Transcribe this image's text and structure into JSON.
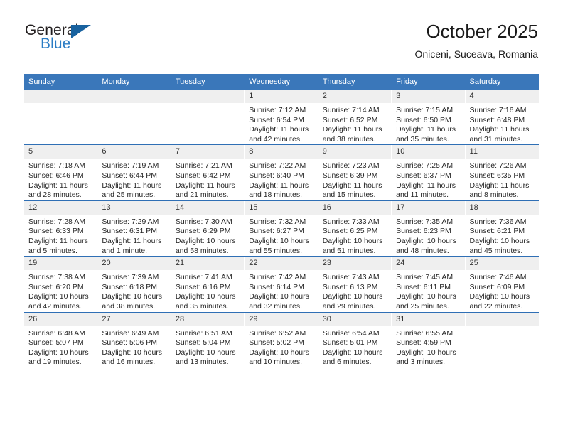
{
  "logo": {
    "word_top": "General",
    "word_bottom": "Blue",
    "accent_color": "#18629f",
    "blue_text_color": "#2b7cc4"
  },
  "header": {
    "title": "October 2025",
    "location": "Oniceni, Suceava, Romania"
  },
  "calendar": {
    "header_bg": "#3a77ba",
    "divider_color": "#2f6fb5",
    "daynum_bg": "#efefef",
    "weekdays": [
      "Sunday",
      "Monday",
      "Tuesday",
      "Wednesday",
      "Thursday",
      "Friday",
      "Saturday"
    ],
    "labels": {
      "sunrise": "Sunrise:",
      "sunset": "Sunset:",
      "daylight": "Daylight:"
    },
    "weeks": [
      [
        {
          "day": ""
        },
        {
          "day": ""
        },
        {
          "day": ""
        },
        {
          "day": "1",
          "sunrise": "Sunrise: 7:12 AM",
          "sunset": "Sunset: 6:54 PM",
          "daylight_1": "Daylight: 11 hours",
          "daylight_2": "and 42 minutes."
        },
        {
          "day": "2",
          "sunrise": "Sunrise: 7:14 AM",
          "sunset": "Sunset: 6:52 PM",
          "daylight_1": "Daylight: 11 hours",
          "daylight_2": "and 38 minutes."
        },
        {
          "day": "3",
          "sunrise": "Sunrise: 7:15 AM",
          "sunset": "Sunset: 6:50 PM",
          "daylight_1": "Daylight: 11 hours",
          "daylight_2": "and 35 minutes."
        },
        {
          "day": "4",
          "sunrise": "Sunrise: 7:16 AM",
          "sunset": "Sunset: 6:48 PM",
          "daylight_1": "Daylight: 11 hours",
          "daylight_2": "and 31 minutes."
        }
      ],
      [
        {
          "day": "5",
          "sunrise": "Sunrise: 7:18 AM",
          "sunset": "Sunset: 6:46 PM",
          "daylight_1": "Daylight: 11 hours",
          "daylight_2": "and 28 minutes."
        },
        {
          "day": "6",
          "sunrise": "Sunrise: 7:19 AM",
          "sunset": "Sunset: 6:44 PM",
          "daylight_1": "Daylight: 11 hours",
          "daylight_2": "and 25 minutes."
        },
        {
          "day": "7",
          "sunrise": "Sunrise: 7:21 AM",
          "sunset": "Sunset: 6:42 PM",
          "daylight_1": "Daylight: 11 hours",
          "daylight_2": "and 21 minutes."
        },
        {
          "day": "8",
          "sunrise": "Sunrise: 7:22 AM",
          "sunset": "Sunset: 6:40 PM",
          "daylight_1": "Daylight: 11 hours",
          "daylight_2": "and 18 minutes."
        },
        {
          "day": "9",
          "sunrise": "Sunrise: 7:23 AM",
          "sunset": "Sunset: 6:39 PM",
          "daylight_1": "Daylight: 11 hours",
          "daylight_2": "and 15 minutes."
        },
        {
          "day": "10",
          "sunrise": "Sunrise: 7:25 AM",
          "sunset": "Sunset: 6:37 PM",
          "daylight_1": "Daylight: 11 hours",
          "daylight_2": "and 11 minutes."
        },
        {
          "day": "11",
          "sunrise": "Sunrise: 7:26 AM",
          "sunset": "Sunset: 6:35 PM",
          "daylight_1": "Daylight: 11 hours",
          "daylight_2": "and 8 minutes."
        }
      ],
      [
        {
          "day": "12",
          "sunrise": "Sunrise: 7:28 AM",
          "sunset": "Sunset: 6:33 PM",
          "daylight_1": "Daylight: 11 hours",
          "daylight_2": "and 5 minutes."
        },
        {
          "day": "13",
          "sunrise": "Sunrise: 7:29 AM",
          "sunset": "Sunset: 6:31 PM",
          "daylight_1": "Daylight: 11 hours",
          "daylight_2": "and 1 minute."
        },
        {
          "day": "14",
          "sunrise": "Sunrise: 7:30 AM",
          "sunset": "Sunset: 6:29 PM",
          "daylight_1": "Daylight: 10 hours",
          "daylight_2": "and 58 minutes."
        },
        {
          "day": "15",
          "sunrise": "Sunrise: 7:32 AM",
          "sunset": "Sunset: 6:27 PM",
          "daylight_1": "Daylight: 10 hours",
          "daylight_2": "and 55 minutes."
        },
        {
          "day": "16",
          "sunrise": "Sunrise: 7:33 AM",
          "sunset": "Sunset: 6:25 PM",
          "daylight_1": "Daylight: 10 hours",
          "daylight_2": "and 51 minutes."
        },
        {
          "day": "17",
          "sunrise": "Sunrise: 7:35 AM",
          "sunset": "Sunset: 6:23 PM",
          "daylight_1": "Daylight: 10 hours",
          "daylight_2": "and 48 minutes."
        },
        {
          "day": "18",
          "sunrise": "Sunrise: 7:36 AM",
          "sunset": "Sunset: 6:21 PM",
          "daylight_1": "Daylight: 10 hours",
          "daylight_2": "and 45 minutes."
        }
      ],
      [
        {
          "day": "19",
          "sunrise": "Sunrise: 7:38 AM",
          "sunset": "Sunset: 6:20 PM",
          "daylight_1": "Daylight: 10 hours",
          "daylight_2": "and 42 minutes."
        },
        {
          "day": "20",
          "sunrise": "Sunrise: 7:39 AM",
          "sunset": "Sunset: 6:18 PM",
          "daylight_1": "Daylight: 10 hours",
          "daylight_2": "and 38 minutes."
        },
        {
          "day": "21",
          "sunrise": "Sunrise: 7:41 AM",
          "sunset": "Sunset: 6:16 PM",
          "daylight_1": "Daylight: 10 hours",
          "daylight_2": "and 35 minutes."
        },
        {
          "day": "22",
          "sunrise": "Sunrise: 7:42 AM",
          "sunset": "Sunset: 6:14 PM",
          "daylight_1": "Daylight: 10 hours",
          "daylight_2": "and 32 minutes."
        },
        {
          "day": "23",
          "sunrise": "Sunrise: 7:43 AM",
          "sunset": "Sunset: 6:13 PM",
          "daylight_1": "Daylight: 10 hours",
          "daylight_2": "and 29 minutes."
        },
        {
          "day": "24",
          "sunrise": "Sunrise: 7:45 AM",
          "sunset": "Sunset: 6:11 PM",
          "daylight_1": "Daylight: 10 hours",
          "daylight_2": "and 25 minutes."
        },
        {
          "day": "25",
          "sunrise": "Sunrise: 7:46 AM",
          "sunset": "Sunset: 6:09 PM",
          "daylight_1": "Daylight: 10 hours",
          "daylight_2": "and 22 minutes."
        }
      ],
      [
        {
          "day": "26",
          "sunrise": "Sunrise: 6:48 AM",
          "sunset": "Sunset: 5:07 PM",
          "daylight_1": "Daylight: 10 hours",
          "daylight_2": "and 19 minutes."
        },
        {
          "day": "27",
          "sunrise": "Sunrise: 6:49 AM",
          "sunset": "Sunset: 5:06 PM",
          "daylight_1": "Daylight: 10 hours",
          "daylight_2": "and 16 minutes."
        },
        {
          "day": "28",
          "sunrise": "Sunrise: 6:51 AM",
          "sunset": "Sunset: 5:04 PM",
          "daylight_1": "Daylight: 10 hours",
          "daylight_2": "and 13 minutes."
        },
        {
          "day": "29",
          "sunrise": "Sunrise: 6:52 AM",
          "sunset": "Sunset: 5:02 PM",
          "daylight_1": "Daylight: 10 hours",
          "daylight_2": "and 10 minutes."
        },
        {
          "day": "30",
          "sunrise": "Sunrise: 6:54 AM",
          "sunset": "Sunset: 5:01 PM",
          "daylight_1": "Daylight: 10 hours",
          "daylight_2": "and 6 minutes."
        },
        {
          "day": "31",
          "sunrise": "Sunrise: 6:55 AM",
          "sunset": "Sunset: 4:59 PM",
          "daylight_1": "Daylight: 10 hours",
          "daylight_2": "and 3 minutes."
        },
        {
          "day": ""
        }
      ]
    ]
  }
}
